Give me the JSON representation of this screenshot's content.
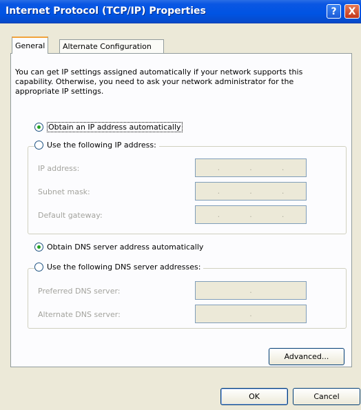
{
  "window": {
    "title": "Internet Protocol (TCP/IP) Properties",
    "help_glyph": "?",
    "close_glyph": "X"
  },
  "tabs": [
    {
      "label": "General",
      "selected": true
    },
    {
      "label": "Alternate Configuration",
      "selected": false
    }
  ],
  "intro_text": "You can get IP settings assigned automatically if your network supports this capability. Otherwise, you need to ask your network administrator for the appropriate IP settings.",
  "ip_section": {
    "auto_label": "Obtain an IP address automatically",
    "manual_label": "Use the following IP address:",
    "selected": "auto",
    "fields": [
      {
        "label": "IP address:"
      },
      {
        "label": "Subnet mask:"
      },
      {
        "label": "Default gateway:"
      }
    ]
  },
  "dns_section": {
    "auto_label": "Obtain DNS server address automatically",
    "manual_label": "Use the following DNS server addresses:",
    "selected": "auto",
    "fields": [
      {
        "label": "Preferred DNS server:"
      },
      {
        "label": "Alternate DNS server:"
      }
    ]
  },
  "ip_dot": ".",
  "buttons": {
    "advanced": "Advanced...",
    "ok": "OK",
    "cancel": "Cancel"
  },
  "colors": {
    "title_bar": "#0054e3",
    "dialog_bg": "#ECE9D8",
    "panel_bg": "#fcfcfe",
    "selected_radio": "#21a121"
  }
}
